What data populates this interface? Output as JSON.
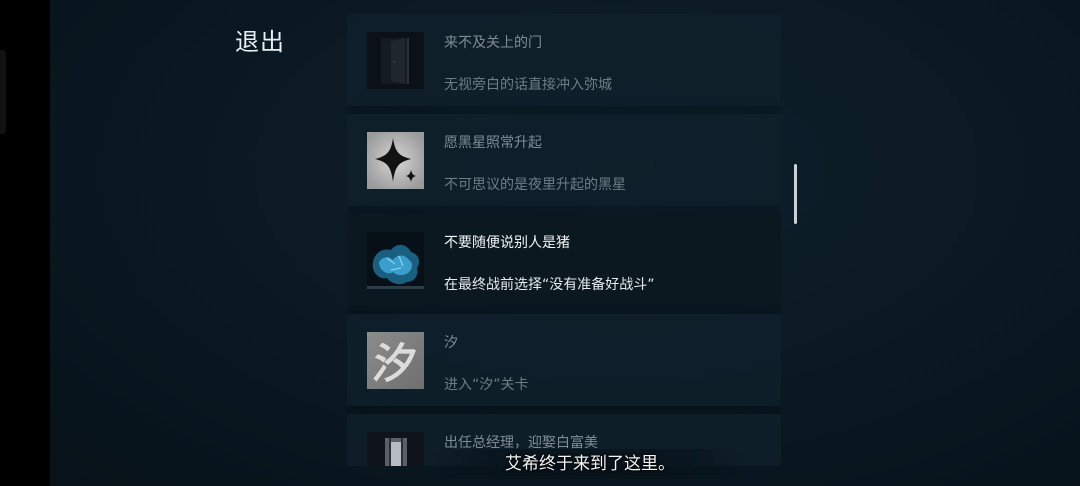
{
  "header": {
    "exit_label": "退出"
  },
  "achievements": [
    {
      "title": "来不及关上的门",
      "description": "无视旁白的话直接冲入弥城",
      "icon": "door-icon",
      "selected": false
    },
    {
      "title": "愿黑星照常升起",
      "description": "不可思议的是夜里升起的黑星",
      "icon": "black-star-icon",
      "selected": false
    },
    {
      "title": "不要随便说别人是猪",
      "description": "在最终战前选择“没有准备好战斗”",
      "icon": "blue-pig-icon",
      "selected": true
    },
    {
      "title": "汐",
      "description": "进入“汐”关卡",
      "icon": "xi-character-icon",
      "icon_glyph": "汐",
      "selected": false
    },
    {
      "title": "出任总经理，迎娶白富美",
      "description": "",
      "icon": "lit-doorway-icon",
      "selected": false
    }
  ],
  "subtitle": "艾希终于来到了这里。",
  "colors": {
    "background": "#0a1822",
    "card": "#10202c",
    "selected_card": "#0b1820",
    "text_primary": "#f2f5f7",
    "text_muted": "#7f8c96"
  }
}
